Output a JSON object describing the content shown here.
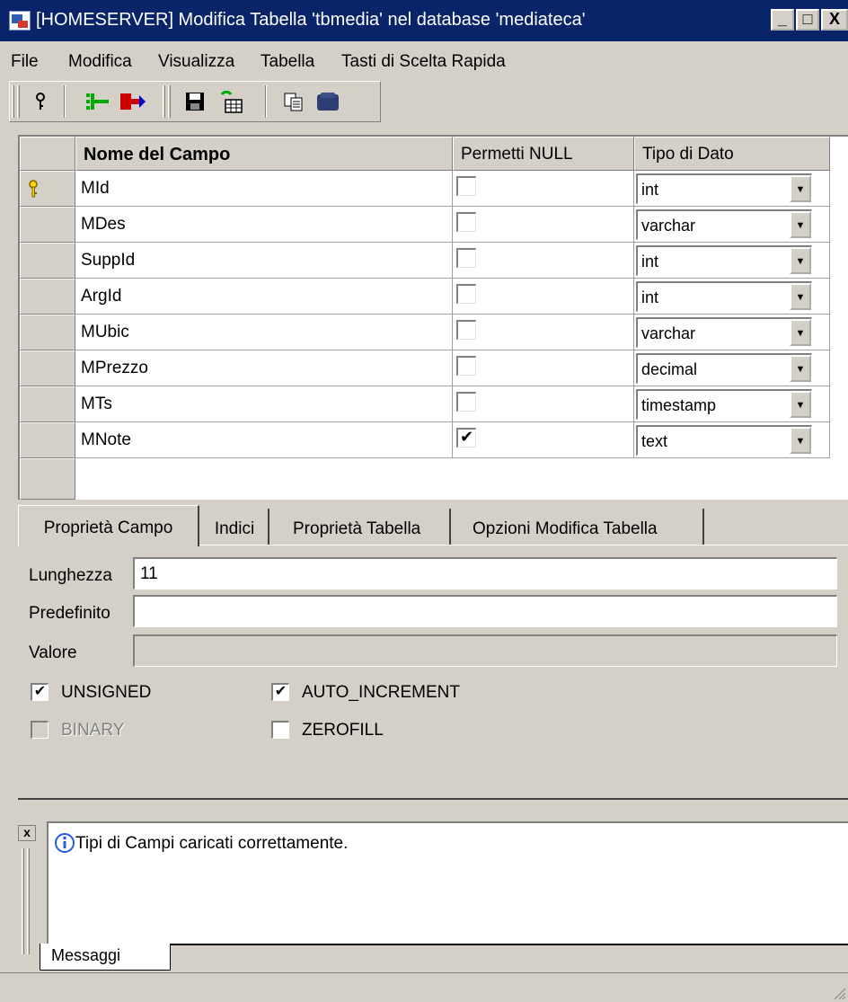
{
  "window": {
    "title": "[HOMESERVER] Modifica Tabella  'tbmedia' nel database 'mediateca'",
    "min_glyph": "_",
    "max_glyph": "□",
    "close_glyph": "X"
  },
  "menu": [
    "File",
    "Modifica",
    "Visualizza",
    "Tabella",
    "Tasti di Scelta Rapida"
  ],
  "toolbar": {
    "icons": [
      "key-icon",
      "insert-field-icon",
      "delete-field-icon",
      "save-icon",
      "refresh-table-icon",
      "copy-icon",
      "database-icon"
    ]
  },
  "grid": {
    "columns": [
      "Nome del Campo",
      "Permetti NULL",
      "Tipo di Dato"
    ],
    "rows": [
      {
        "name": "MId",
        "allow_null": false,
        "type": "int",
        "primary_key": true
      },
      {
        "name": "MDes",
        "allow_null": false,
        "type": "varchar",
        "primary_key": false
      },
      {
        "name": "SuppId",
        "allow_null": false,
        "type": "int",
        "primary_key": false
      },
      {
        "name": "ArgId",
        "allow_null": false,
        "type": "int",
        "primary_key": false
      },
      {
        "name": "MUbic",
        "allow_null": false,
        "type": "varchar",
        "primary_key": false
      },
      {
        "name": "MPrezzo",
        "allow_null": false,
        "type": "decimal",
        "primary_key": false
      },
      {
        "name": "MTs",
        "allow_null": false,
        "type": "timestamp",
        "primary_key": false
      },
      {
        "name": "MNote",
        "allow_null": true,
        "type": "text",
        "primary_key": false
      }
    ]
  },
  "tabs": [
    "Proprietà Campo",
    "Indici",
    "Proprietà Tabella",
    "Opzioni Modifica Tabella"
  ],
  "active_tab": 0,
  "properties": {
    "length_label": "Lunghezza",
    "length_value": "11",
    "default_label": "Predefinito",
    "default_value": "",
    "value_label": "Valore",
    "value_value": "",
    "unsigned_label": "UNSIGNED",
    "unsigned_checked": true,
    "auto_increment_label": "AUTO_INCREMENT",
    "auto_increment_checked": true,
    "binary_label": "BINARY",
    "binary_checked": false,
    "binary_enabled": false,
    "zerofill_label": "ZEROFILL",
    "zerofill_checked": false
  },
  "messages": {
    "close_glyph": "x",
    "text": "Tipi di Campi caricati correttamente.",
    "tab_label": "Messaggi"
  },
  "colors": {
    "titlebar": "#0a246a",
    "face": "#d4d0c8",
    "disabled_text": "#808080"
  }
}
